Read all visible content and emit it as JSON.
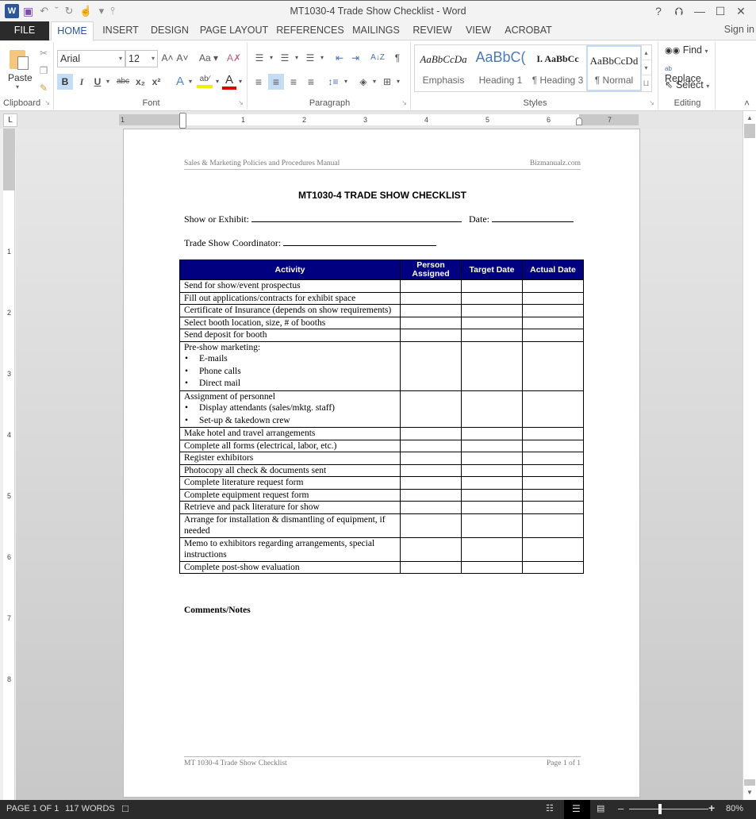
{
  "titlebar": {
    "title": "MT1030-4 Trade Show Checklist - Word",
    "qat": {
      "word_icon": "W",
      "save_icon": "💾",
      "undo_icon": "↶",
      "undo_dd": "ˇ",
      "redo_icon": "↻",
      "touch_icon": "☝",
      "touch_dd": "▾",
      "customize_icon": "⫯"
    },
    "window": {
      "help": "?",
      "restore_ribbon": "⮉",
      "minimize": "—",
      "maximize": "☐",
      "close": "✕"
    }
  },
  "tabs": [
    "FILE",
    "HOME",
    "INSERT",
    "DESIGN",
    "PAGE LAYOUT",
    "REFERENCES",
    "MAILINGS",
    "REVIEW",
    "VIEW",
    "ACROBAT"
  ],
  "sign_in": "Sign in",
  "ribbon": {
    "clipboard": {
      "label": "Clipboard",
      "paste": "Paste",
      "paste_dd": "▾",
      "cut": "✂",
      "copy": "❐",
      "format_painter": "🖌"
    },
    "font": {
      "label": "Font",
      "font_name": "Arial",
      "font_size": "12",
      "grow": "A˄",
      "shrink": "A˅",
      "change_case": "Aa ▾",
      "clear_formatting": "A✗",
      "bold": "B",
      "italic": "I",
      "underline": "U",
      "underline_dd": "▾",
      "strikethrough": "abc",
      "subscript": "x₂",
      "superscript": "x²",
      "text_effects": "A",
      "highlight": "ab∕",
      "font_color": "A",
      "dd": "▾"
    },
    "paragraph": {
      "label": "Paragraph",
      "bullets": "☰",
      "numbering": "☰",
      "multilevel": "☰",
      "decrease_indent": "⇤",
      "increase_indent": "⇥",
      "sort": "A↓Z",
      "show_marks": "¶",
      "align_left": "≡",
      "center": "≡",
      "align_right": "≡",
      "justify": "≡",
      "line_spacing": "↕≡",
      "shading": "◈",
      "borders": "⊞",
      "dd": "▾"
    },
    "styles": {
      "label": "Styles",
      "items": [
        {
          "sample": "AaBbCcDa",
          "name": "Emphasis"
        },
        {
          "sample": "AaBbC(",
          "name": "Heading 1"
        },
        {
          "sample": "I.  AaBbCc",
          "name": "¶ Heading 3"
        },
        {
          "sample": "AaBbCcDd",
          "name": "¶ Normal"
        }
      ],
      "scroll_up": "▴",
      "scroll_down": "▾",
      "more": "⨆"
    },
    "editing": {
      "label": "Editing",
      "find": "Find",
      "replace": "Replace",
      "select": "Select",
      "find_icon": "🔭",
      "replace_icon": "↔",
      "select_icon": "⇖",
      "dd": "▾"
    },
    "collapse": "˄",
    "launcher": "↘"
  },
  "ruler": {
    "tab_selector": "L",
    "marks": [
      "1",
      "1",
      "2",
      "3",
      "4",
      "5",
      "6",
      "7"
    ],
    "vmarks": [
      "1",
      "2",
      "3",
      "4",
      "5",
      "6",
      "7",
      "8"
    ]
  },
  "scrollbar": {
    "up": "▲",
    "down": "▼"
  },
  "document": {
    "header_left": "Sales & Marketing Policies and Procedures Manual",
    "header_right": "Bizmanualz.com",
    "title": "MT1030-4 TRADE SHOW CHECKLIST",
    "show_label": "Show or Exhibit:",
    "date_label": "Date:",
    "coordinator_label": "Trade Show Coordinator:",
    "table": {
      "headers": [
        "Activity",
        "Person Assigned",
        "Target Date",
        "Actual Date"
      ],
      "rows": [
        {
          "activity": "Send for show/event prospectus"
        },
        {
          "activity": "Fill out applications/contracts for exhibit space"
        },
        {
          "activity": "Certificate of Insurance (depends on show requirements)"
        },
        {
          "activity": "Select booth location, size, # of booths"
        },
        {
          "activity": "Send deposit for booth"
        },
        {
          "activity": "Pre-show marketing:",
          "bullets": [
            "E-mails",
            "Phone calls",
            "Direct mail"
          ]
        },
        {
          "activity": "Assignment of personnel",
          "bullets": [
            "Display attendants (sales/mktg. staff)",
            "Set-up & takedown crew"
          ]
        },
        {
          "activity": "Make hotel and travel arrangements"
        },
        {
          "activity": "Complete all forms (electrical, labor, etc.)"
        },
        {
          "activity": "Register exhibitors"
        },
        {
          "activity": "Photocopy all check & documents sent"
        },
        {
          "activity": "Complete literature request form"
        },
        {
          "activity": "Complete equipment request form"
        },
        {
          "activity": "Retrieve and pack literature for show"
        },
        {
          "activity": "Arrange for installation & dismantling of equipment, if needed"
        },
        {
          "activity": "Memo to exhibitors regarding arrangements, special instructions"
        },
        {
          "activity": "Complete post-show evaluation"
        }
      ]
    },
    "comments_label": "Comments/Notes",
    "footer_left": "MT 1030-4 Trade Show Checklist",
    "footer_right": "Page 1 of 1"
  },
  "status": {
    "page": "PAGE 1 OF 1",
    "words": "117 WORDS",
    "proofing_icon": "📖",
    "read_mode_icon": "📖",
    "print_layout_icon": "☰",
    "web_layout_icon": "🗔",
    "zoom_out": "–",
    "zoom_in": "+",
    "zoom": "80%",
    "zoom_percent": 80
  },
  "colors": {
    "accent": "#2b579a",
    "table_header": "#000080",
    "status_bar": "#2b2b2b"
  }
}
